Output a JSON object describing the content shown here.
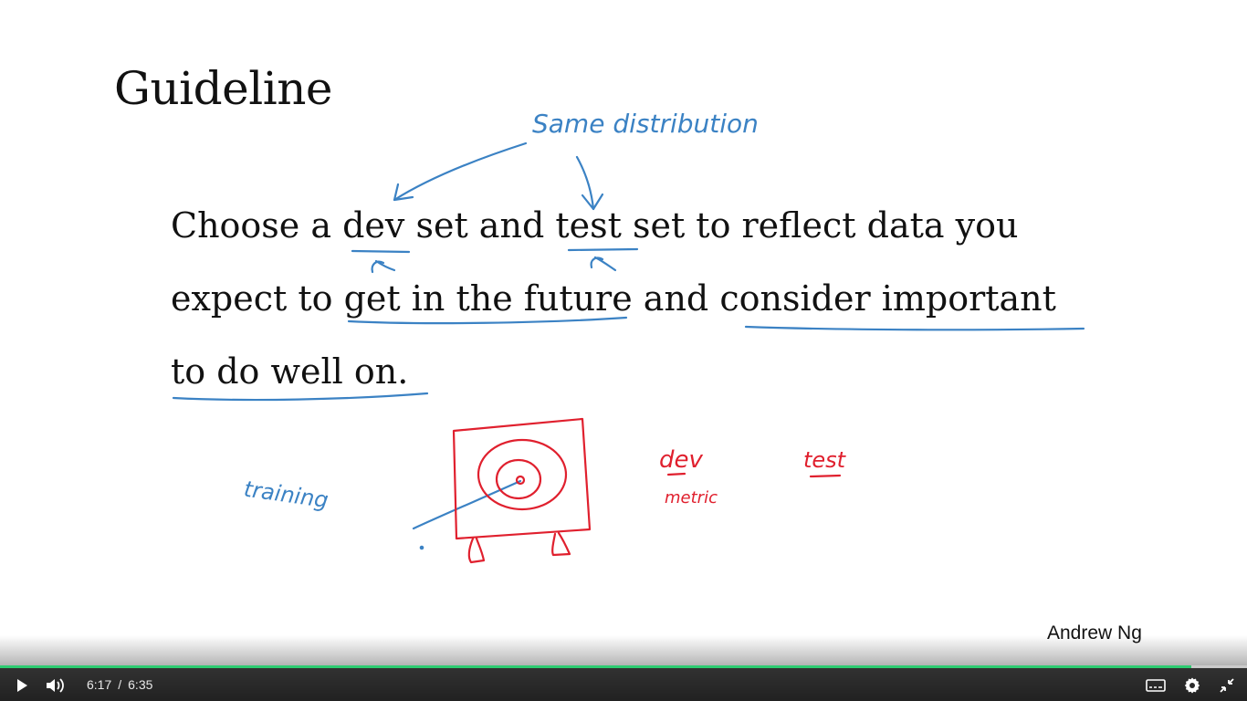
{
  "slide": {
    "title": "Guideline",
    "lines": [
      [
        "Choose a ",
        "dev",
        " set and ",
        "test",
        " set to reflect data you"
      ],
      [
        "expect to ",
        "get in the future",
        " and ",
        "consider important"
      ],
      [
        "to do well on."
      ]
    ],
    "annotations": {
      "same_distribution": "Same distribution",
      "training": "training",
      "dev": "dev",
      "metric": "metric",
      "test": "test"
    },
    "ink_colors": {
      "blue": "#3b82c4",
      "red": "#e0202e"
    }
  },
  "credit": "Andrew Ng",
  "player": {
    "current_time": "6:17",
    "separator": "/",
    "duration": "6:35",
    "progress": 0.955,
    "accent": "#2ecc71",
    "icons": {
      "play": "play-icon",
      "volume": "volume-icon",
      "captions": "captions-icon",
      "settings": "gear-icon",
      "fullscreen": "exit-fullscreen-icon"
    }
  }
}
